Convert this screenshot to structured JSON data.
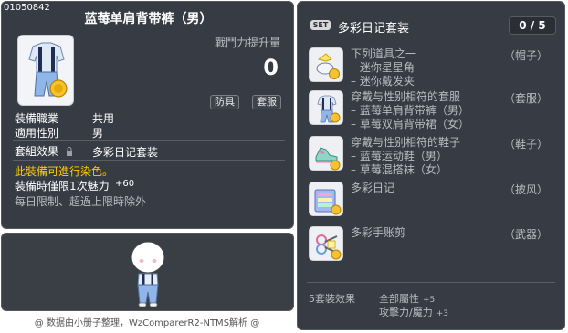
{
  "item": {
    "id": "01050842",
    "title": "蓝莓单肩背带裤（男）",
    "power_label": "戰鬥力提升量",
    "power_value": "0",
    "tags": [
      "防具",
      "套服"
    ],
    "job_label": "裝備職業",
    "job_value": "共用",
    "gender_label": "適用性別",
    "gender_value": "男",
    "set_label": "套組效果",
    "set_value": "多彩日记套装",
    "dye_note": "此裝備可進行染色。",
    "limit_label": "裝備時僅限1次魅力",
    "limit_value": "+60",
    "daily_limit": "每日限制、超過上限時除外"
  },
  "set": {
    "badge": "SET",
    "name": "多彩日记套装",
    "count": "0 / 5",
    "rows": [
      {
        "lines": [
          "下列道具之一",
          "– 迷你星星角",
          "– 迷你戴发夹"
        ],
        "slot": "（帽子）",
        "icon": "mini-hat-icon"
      },
      {
        "lines": [
          "穿戴与性别相符的套服",
          "– 蓝莓单肩背带裤（男）",
          "– 草莓双肩背带裙（女）"
        ],
        "slot": "（套服）",
        "icon": "overall-icon"
      },
      {
        "lines": [
          "穿戴与性别相符的鞋子",
          "– 蓝莓运动鞋（男）",
          "– 草莓混搭袜（女）"
        ],
        "slot": "（鞋子）",
        "icon": "shoes-icon"
      },
      {
        "lines": [
          "多彩日记"
        ],
        "slot": "（披风）",
        "icon": "cape-icon"
      },
      {
        "lines": [
          "多彩手账剪"
        ],
        "slot": "（武器）",
        "icon": "weapon-icon"
      }
    ],
    "effect_label": "5套裝效果",
    "effects": [
      {
        "text": "全部屬性",
        "value": "+5"
      },
      {
        "text": "攻擊力/魔力",
        "value": "+3"
      }
    ]
  },
  "footer": "@ 数据由小册子整理，WzComparerR2-NTMS解析 @",
  "colors": {
    "panel": "#373c44",
    "highlight": "#ffcc00",
    "muted": "#b7bbc2"
  }
}
